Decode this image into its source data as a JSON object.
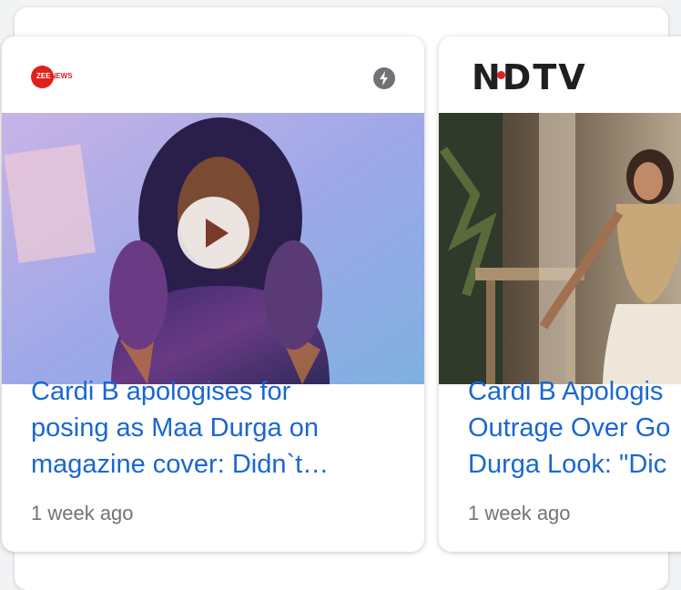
{
  "cards": [
    {
      "source": "ZEENEWS",
      "source_short": "ZEE",
      "source_suffix": "NEWS",
      "has_amp": true,
      "has_video": true,
      "title_lines": [
        "Cardi B apologises for",
        "posing as Maa Durga on",
        "magazine cover: Didn`t…"
      ],
      "time": "1 week ago"
    },
    {
      "source": "NDTV",
      "has_amp": false,
      "has_video": false,
      "title_lines": [
        "Cardi B Apologis",
        "Outrage Over Go",
        "Durga Look: \"Dic"
      ],
      "time": "1 week ago"
    }
  ],
  "icons": {
    "amp": "lightning-bolt-icon",
    "play": "play-icon"
  },
  "colors": {
    "title": "#1967d2",
    "time": "#70757a",
    "brand_red": "#e0201c"
  }
}
